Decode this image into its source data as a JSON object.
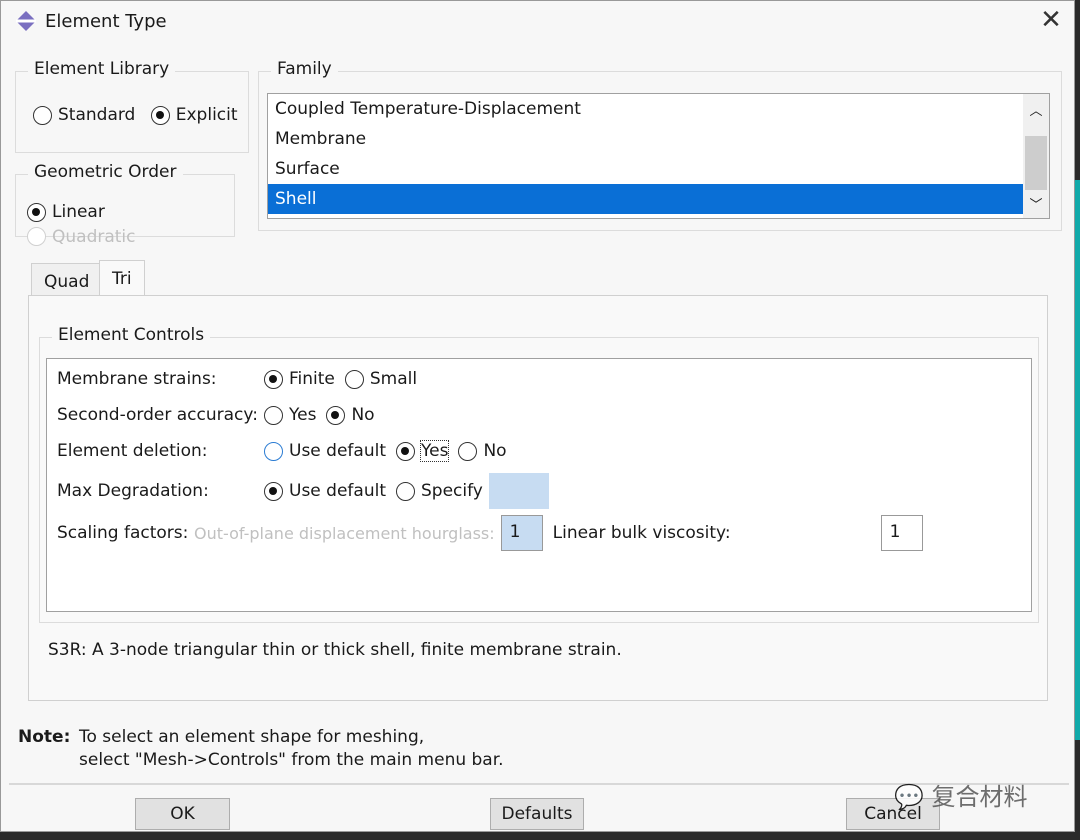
{
  "window": {
    "title": "Element Type",
    "icon": "abaqus-logo-icon",
    "close_icon": "close-icon"
  },
  "element_library": {
    "label": "Element Library",
    "options": [
      "Standard",
      "Explicit"
    ],
    "selected": "Explicit"
  },
  "geometric_order": {
    "label": "Geometric Order",
    "options": [
      "Linear",
      "Quadratic"
    ],
    "selected": "Linear",
    "disabled": [
      "Quadratic"
    ]
  },
  "family": {
    "label": "Family",
    "items": [
      "Coupled Temperature-Displacement",
      "Membrane",
      "Surface",
      "Shell"
    ],
    "selected": "Shell"
  },
  "tabs": [
    {
      "label": "Quad"
    },
    {
      "label": "Tri",
      "active": true
    }
  ],
  "element_controls": {
    "label": "Element Controls",
    "membrane_strains": {
      "label": "Membrane strains:",
      "options": [
        "Finite",
        "Small"
      ],
      "selected": "Finite"
    },
    "second_order_accuracy": {
      "label": "Second-order accuracy:",
      "options": [
        "Yes",
        "No"
      ],
      "selected": "No"
    },
    "element_deletion": {
      "label": "Element deletion:",
      "options": [
        "Use default",
        "Yes",
        "No"
      ],
      "selected": "Yes"
    },
    "max_degradation": {
      "label": "Max Degradation:",
      "options": [
        "Use default",
        "Specify"
      ],
      "selected": "Use default",
      "value": ""
    },
    "scaling_factors": {
      "label": "Scaling factors:",
      "hourglass_label": "Out-of-plane displacement hourglass:",
      "hourglass_value": "1",
      "bulk_label": "Linear bulk viscosity:",
      "bulk_value": "1"
    }
  },
  "description": "S3R:  A 3-node triangular thin or thick shell, finite membrane strain.",
  "note": {
    "label": "Note:",
    "line1": "To select an element shape for meshing,",
    "line2": "select \"Mesh->Controls\" from the main menu bar."
  },
  "buttons": {
    "ok": "OK",
    "defaults": "Defaults",
    "cancel": "Cancel"
  },
  "watermark": "复合材料",
  "colors": {
    "selection": "#0a6fd6",
    "field_highlight": "#c7dcf2"
  }
}
